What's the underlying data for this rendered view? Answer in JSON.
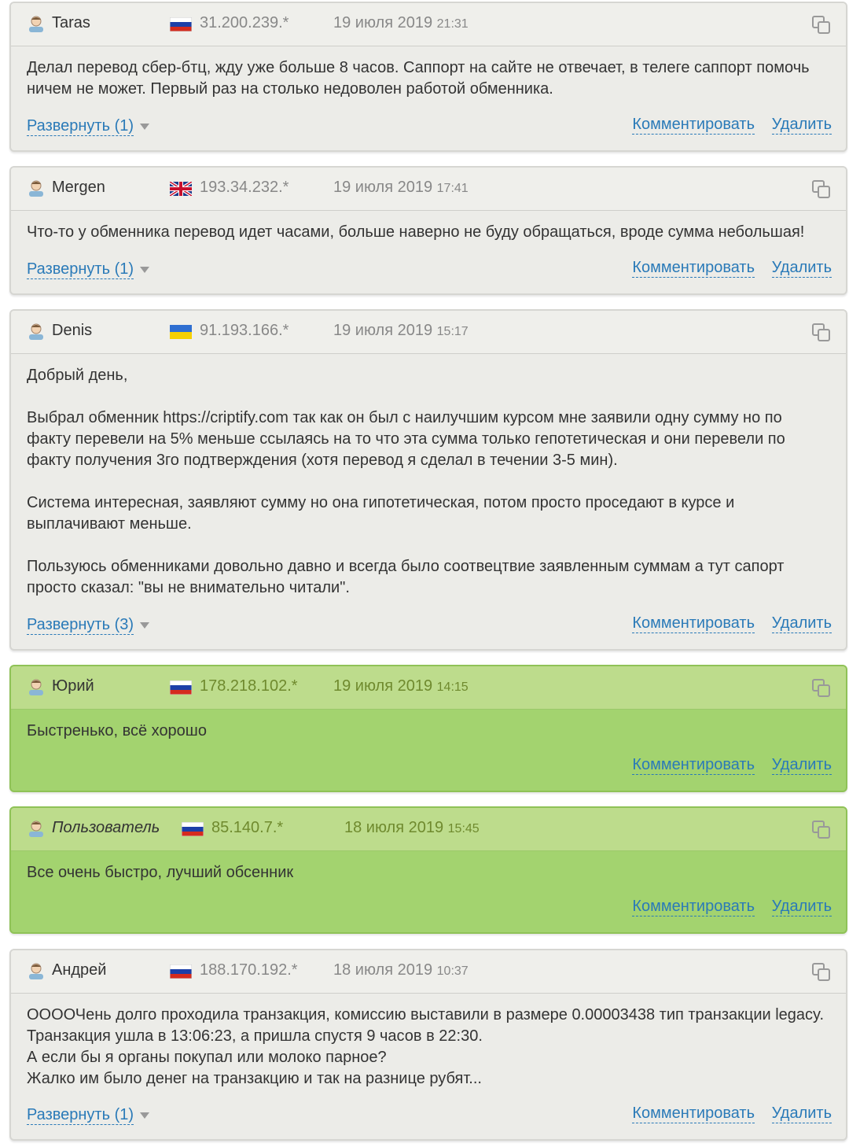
{
  "actions": {
    "comment_label": "Комментировать",
    "delete_label": "Удалить"
  },
  "reviews": [
    {
      "author": "Taras",
      "flag": "ru",
      "ip": "31.200.239.*",
      "date": "19 июля 2019",
      "time": "21:31",
      "paragraphs": [
        "Делал перевод сбер-бтц, жду уже больше 8 часов. Саппорт на сайте не отвечает, в телеге саппорт помочь ничем не может. Первый раз на столько недоволен работой обменника."
      ],
      "expand_label": "Развернуть (1)",
      "status": "negative"
    },
    {
      "author": "Mergen",
      "flag": "gb",
      "ip": "193.34.232.*",
      "date": "19 июля 2019",
      "time": "17:41",
      "paragraphs": [
        "Что-то у обменника перевод идет часами, больше наверно не буду обращаться, вроде сумма небольшая!"
      ],
      "expand_label": "Развернуть (1)",
      "status": "negative"
    },
    {
      "author": "Denis",
      "flag": "ua",
      "ip": "91.193.166.*",
      "date": "19 июля 2019",
      "time": "15:17",
      "paragraphs": [
        "Добрый день,",
        "Выбрал обменник https://criptify.com так как он был с наилучшим курсом мне заявили одну сумму но по факту перевели на 5% меньше ссылаясь на то что эта сумма только гепотетическая и они перевели по факту получения 3го подтверждения (хотя перевод я сделал в течении 3-5 мин).",
        "Система интересная, заявляют сумму но она гипотетическая, потом просто проседают в курсе и выплачивают меньше.",
        "Пользуюсь обменниками довольно давно и всегда было соотвецтвие заявленным суммам а тут сапорт просто сказал: \"вы не внимательно читали\"."
      ],
      "expand_label": "Развернуть (3)",
      "status": "negative"
    },
    {
      "author": "Юрий",
      "flag": "ru",
      "ip": "178.218.102.*",
      "date": "19 июля 2019",
      "time": "14:15",
      "paragraphs": [
        "Быстренько, всё хорошо"
      ],
      "expand_label": "",
      "status": "positive"
    },
    {
      "author": "Пользователь",
      "flag": "ru",
      "ip": "85.140.7.*",
      "date": "18 июля 2019",
      "time": "15:45",
      "paragraphs": [
        "Все очень быстро, лучший обсенник"
      ],
      "expand_label": "",
      "status": "positive"
    },
    {
      "author": "Андрей",
      "flag": "ru",
      "ip": "188.170.192.*",
      "date": "18 июля 2019",
      "time": "10:37",
      "lines": [
        "ООООЧень долго проходила транзакция, комиссию выставили в размере 0.00003438 тип транзакции legacy.",
        "Транзакция ушла в 13:06:23, а пришла спустя 9 часов в 22:30.",
        "А если бы я органы покупал или молоко парное?",
        "Жалко им было денег на транзакцию и так на разнице рубят..."
      ],
      "expand_label": "Развернуть (1)",
      "status": "negative"
    }
  ]
}
